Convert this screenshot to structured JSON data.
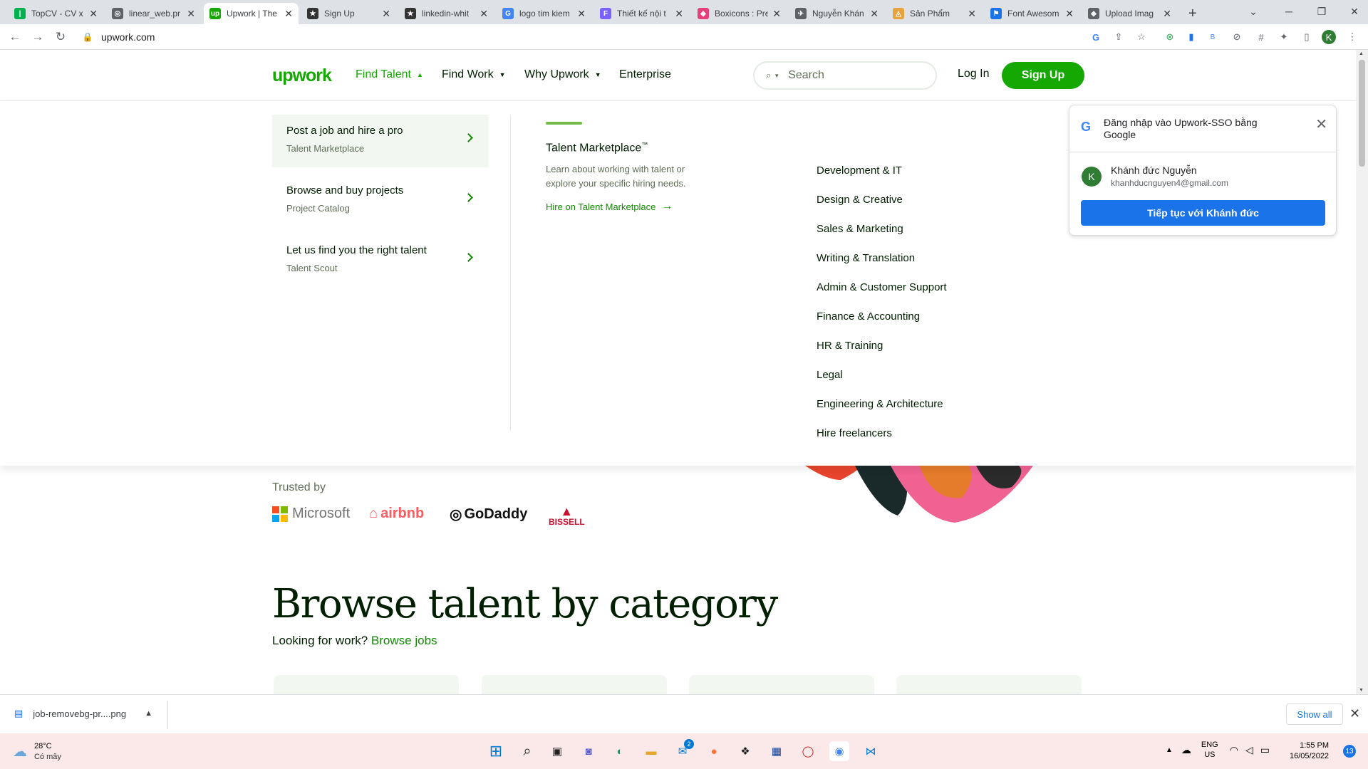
{
  "browser": {
    "tabs": [
      {
        "title": "TopCV - CV x",
        "fav_color": "#00b14f",
        "fav_char": "|"
      },
      {
        "title": "linear_web.pr",
        "fav_color": "#5f6368",
        "fav_char": "◎"
      },
      {
        "title": "Upwork | The",
        "fav_color": "#14a800",
        "fav_char": "up",
        "active": true
      },
      {
        "title": "Sign Up",
        "fav_color": "#333333",
        "fav_char": "★"
      },
      {
        "title": "linkedin-whit",
        "fav_color": "#333333",
        "fav_char": "★"
      },
      {
        "title": "logo tim kiem",
        "fav_color": "#4285f4",
        "fav_char": "G"
      },
      {
        "title": "Thiết kế nội t",
        "fav_color": "#7b61ff",
        "fav_char": "F"
      },
      {
        "title": "Boxicons : Pre",
        "fav_color": "#e6407a",
        "fav_char": "◆"
      },
      {
        "title": "Nguyễn Khán",
        "fav_color": "#5f6368",
        "fav_char": "✈"
      },
      {
        "title": "Sản Phẩm",
        "fav_color": "#e6a23c",
        "fav_char": "◬"
      },
      {
        "title": "Font Awesom",
        "fav_color": "#1a73e8",
        "fav_char": "⚑"
      },
      {
        "title": "Upload Imag",
        "fav_color": "#5f6368",
        "fav_char": "◈"
      }
    ],
    "new_tab": "+",
    "url": "upwork.com",
    "profile_initial": "K"
  },
  "nav": {
    "logo": "upwork",
    "find_talent": "Find Talent",
    "find_work": "Find Work",
    "why_upwork": "Why Upwork",
    "enterprise": "Enterprise",
    "search_placeholder": "Search",
    "login": "Log In",
    "signup": "Sign Up"
  },
  "mega": {
    "items": [
      {
        "title": "Post a job and hire a pro",
        "sub": "Talent Marketplace"
      },
      {
        "title": "Browse and buy projects",
        "sub": "Project Catalog"
      },
      {
        "title": "Let us find you the right talent",
        "sub": "Talent Scout"
      }
    ],
    "tm_title": "Talent Marketplace",
    "tm_tm": "™",
    "tm_desc": "Learn about working with talent or explore your specific hiring needs.",
    "tm_link": "Hire on Talent Marketplace",
    "categories": [
      "Development & IT",
      "Design & Creative",
      "Sales & Marketing",
      "Writing & Translation",
      "Admin & Customer Support",
      "Finance & Accounting",
      "HR & Training",
      "Legal",
      "Engineering & Architecture",
      "Hire freelancers"
    ]
  },
  "google_popup": {
    "title": "Đăng nhập vào Upwork-SSO bằng Google",
    "avatar": "K",
    "name": "Khánh đức Nguyễn",
    "email": "khanhducnguyen4@gmail.com",
    "button": "Tiếp tục với Khánh đức"
  },
  "page": {
    "trusted_by": "Trusted by",
    "brands": [
      "Microsoft",
      "airbnb",
      "GoDaddy",
      "BISSELL"
    ],
    "heading": "Browse talent by category",
    "looking": "Looking for work?",
    "browse_jobs": "Browse jobs"
  },
  "download": {
    "file": "job-removebg-pr....png",
    "show_all": "Show all"
  },
  "taskbar": {
    "temp": "28°C",
    "weather": "Có mây",
    "lang": "ENG",
    "region": "US",
    "time": "1:55 PM",
    "date": "16/05/2022",
    "notifications": "13",
    "mail_badge": "2"
  }
}
